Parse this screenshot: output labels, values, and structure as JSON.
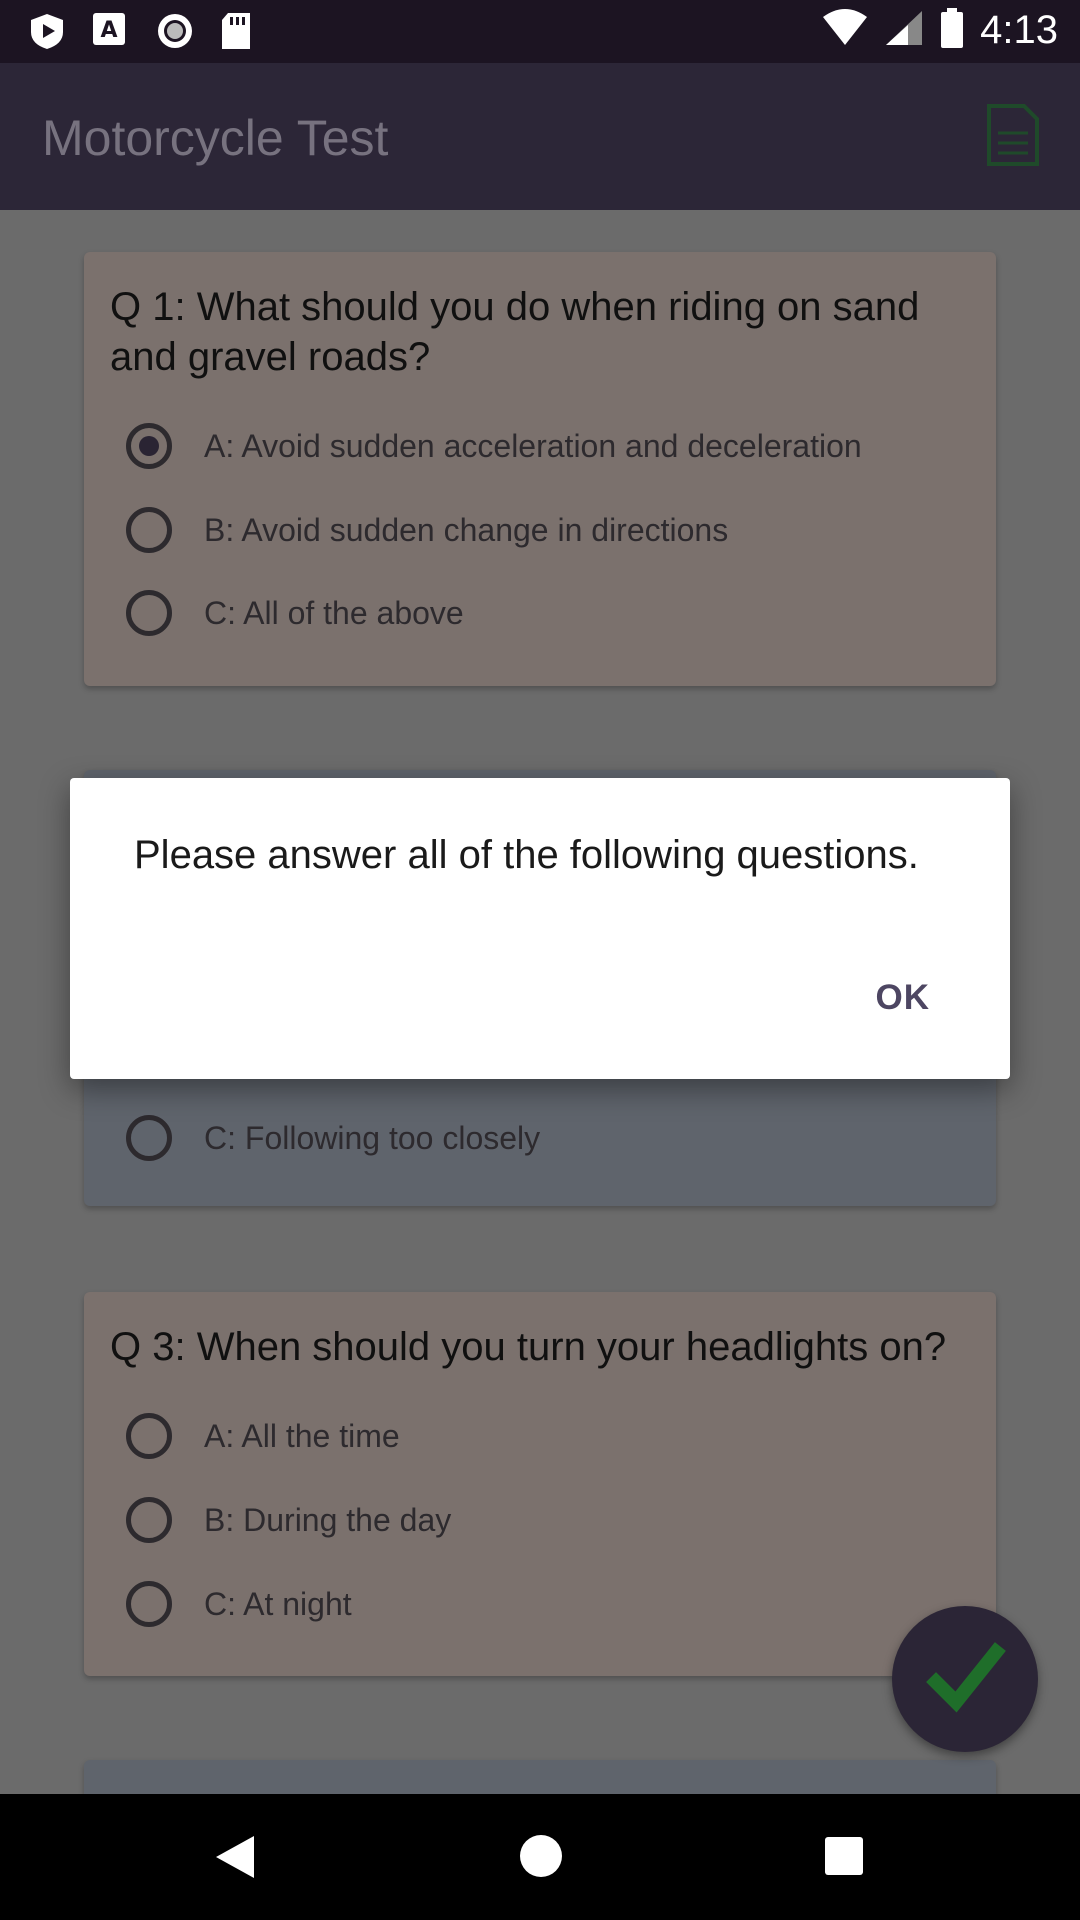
{
  "status_bar": {
    "time": "4:13",
    "icons": [
      "play-protect-icon",
      "font-app-icon",
      "record-icon",
      "sd-card-icon",
      "wifi-icon",
      "signal-icon",
      "battery-icon"
    ]
  },
  "app_bar": {
    "title": "Motorcycle Test",
    "action_icon": "document-icon"
  },
  "questions": [
    {
      "text": "Q 1: What should you do when riding on sand and gravel roads?",
      "options": [
        {
          "label": "A: Avoid sudden acceleration and deceleration",
          "checked": true
        },
        {
          "label": "B: Avoid sudden change in directions",
          "checked": false
        },
        {
          "label": "C: All of the above",
          "checked": false
        }
      ]
    },
    {
      "text": "",
      "options": [
        {
          "label": "C: Following too closely",
          "checked": false
        }
      ]
    },
    {
      "text": "Q 3: When should you turn your headlights on?",
      "options": [
        {
          "label": "A: All the time",
          "checked": false
        },
        {
          "label": "B: During the day",
          "checked": false
        },
        {
          "label": "C: At night",
          "checked": false
        }
      ]
    }
  ],
  "dialog": {
    "message": "Please answer all of the following questions.",
    "ok_label": "OK"
  },
  "fab": {
    "icon": "checkmark-icon",
    "icon_color": "#1f6e2a"
  },
  "colors": {
    "status_bar": "#1c1422",
    "app_bar": "#2c2637",
    "card": "#7b716d",
    "dialog_button": "#4d4662"
  },
  "nav_bar": {
    "icons": [
      "back-icon",
      "home-icon",
      "recents-icon"
    ]
  }
}
